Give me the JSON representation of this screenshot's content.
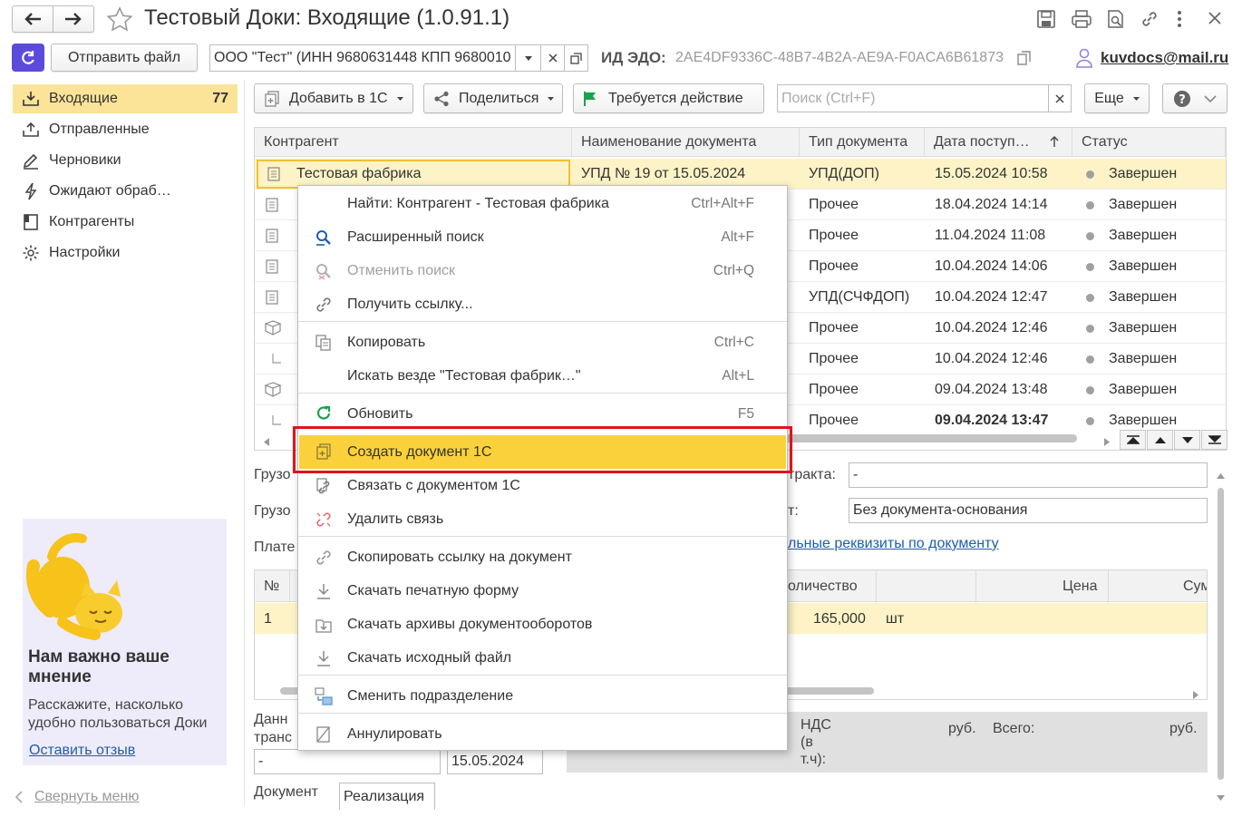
{
  "window": {
    "title": "Тестовый Доки: Входящие (1.0.91.1)"
  },
  "toolbar": {
    "send_file": "Отправить файл",
    "org_field": "ООО \"Тест\" (ИНН 9680631448 КПП 9680010",
    "edo_label": "ИД ЭДО:",
    "edo_value": "2AE4DF9336C-48B7-4B2A-AE9A-F0ACA6B61873",
    "user_email": "kuvdocs@mail.ru"
  },
  "sidebar": {
    "items": [
      {
        "label": "Входящие",
        "badge": "77"
      },
      {
        "label": "Отправленные"
      },
      {
        "label": "Черновики"
      },
      {
        "label": "Ожидают обраб…"
      },
      {
        "label": "Контрагенты"
      },
      {
        "label": "Настройки"
      }
    ],
    "feedback": {
      "title": "Нам важно ваше мнение",
      "text": "Расскажите, насколько удобно пользоваться Доки",
      "link": "Оставить отзыв"
    },
    "collapse": "Свернуть меню"
  },
  "actions": {
    "add_1c": "Добавить в 1С",
    "share": "Поделиться",
    "action_required": "Требуется действие",
    "search_placeholder": "Поиск (Ctrl+F)",
    "more": "Еще"
  },
  "grid": {
    "headers": [
      "Контрагент",
      "Наименование документа",
      "Тип документа",
      "Дата поступ…",
      "Статус"
    ],
    "rows": [
      {
        "counterparty": "Тестовая фабрика",
        "name": "УПД № 19 от 15.05.2024",
        "type": "УПД(ДОП)",
        "date": "15.05.2024 10:58",
        "status": "Завершен"
      },
      {
        "counterparty": "",
        "name": "",
        "type": "Прочее",
        "date": "18.04.2024 14:14",
        "status": "Завершен"
      },
      {
        "counterparty": "",
        "name": "",
        "type": "Прочее",
        "date": "11.04.2024 11:08",
        "status": "Завершен"
      },
      {
        "counterparty": "",
        "name": "",
        "type": "Прочее",
        "date": "10.04.2024 14:06",
        "status": "Завершен"
      },
      {
        "counterparty": "",
        "name": "",
        "type": "УПД(СЧФДОП)",
        "date": "10.04.2024 12:47",
        "status": "Завершен"
      },
      {
        "counterparty": "",
        "name": "",
        "type": "Прочее",
        "date": "10.04.2024 12:46",
        "status": "Завершен"
      },
      {
        "counterparty": "",
        "name": "",
        "type": "Прочее",
        "date": "10.04.2024 12:46",
        "status": "Завершен"
      },
      {
        "counterparty": "",
        "name": "",
        "type": "Прочее",
        "date": "09.04.2024 13:48",
        "status": "Завершен"
      },
      {
        "counterparty": "",
        "name": "",
        "type": "Прочее",
        "date": "09.04.2024 13:47",
        "status": "Завершен"
      }
    ]
  },
  "details": {
    "shipper_label_1": "Грузо",
    "shipper_label_2": "Грузо",
    "payer_label": "Плате",
    "contract_label": "трактa:",
    "contract_value": "-",
    "basis_label": "т:",
    "basis_value": "Без документа-основания",
    "extra_link": "льные реквизиты по документу",
    "items_headers": {
      "num": "№",
      "qty": "оличество",
      "price": "Цена",
      "sum": "Сум"
    },
    "item_row": {
      "num": "1",
      "qty": "165,000",
      "unit": "шт"
    },
    "transport_label_1": "Данн",
    "transport_label_2": "транс",
    "transport_value": "-",
    "date_value": "15.05.2024",
    "vat_label_1": "НДС",
    "vat_label_2": "(в",
    "vat_label_3": "т.ч):",
    "vat_currency": "руб.",
    "total_label": "Всего:",
    "total_currency": "руб.",
    "document_label": "Документ",
    "document_value": "Реализация"
  },
  "context_menu": {
    "items": [
      {
        "label": "Найти: Контрагент - Тестовая фабрика",
        "shortcut": "Ctrl+Alt+F"
      },
      {
        "label": "Расширенный поиск",
        "shortcut": "Alt+F"
      },
      {
        "label": "Отменить поиск",
        "shortcut": "Ctrl+Q"
      },
      {
        "label": "Получить ссылку...",
        "shortcut": ""
      },
      {
        "label": "Копировать",
        "shortcut": "Ctrl+C"
      },
      {
        "label": "Искать везде \"Тестовая фабрик…\"",
        "shortcut": "Alt+L"
      },
      {
        "label": "Обновить",
        "shortcut": "F5"
      },
      {
        "label": "Создать документ 1С",
        "shortcut": ""
      },
      {
        "label": "Связать с документом 1С",
        "shortcut": ""
      },
      {
        "label": "Удалить связь",
        "shortcut": ""
      },
      {
        "label": "Скопировать ссылку на документ",
        "shortcut": ""
      },
      {
        "label": "Скачать печатную форму",
        "shortcut": ""
      },
      {
        "label": "Скачать архивы документооборотов",
        "shortcut": ""
      },
      {
        "label": "Скачать исходный файл",
        "shortcut": ""
      },
      {
        "label": "Сменить подразделение",
        "shortcut": ""
      },
      {
        "label": "Аннулировать",
        "shortcut": ""
      }
    ]
  },
  "colors": {
    "accent_yellow": "#fbd13b",
    "selected_row": "#fdf3c6",
    "highlight_border": "#e0141e",
    "link": "#1f5ea8"
  }
}
